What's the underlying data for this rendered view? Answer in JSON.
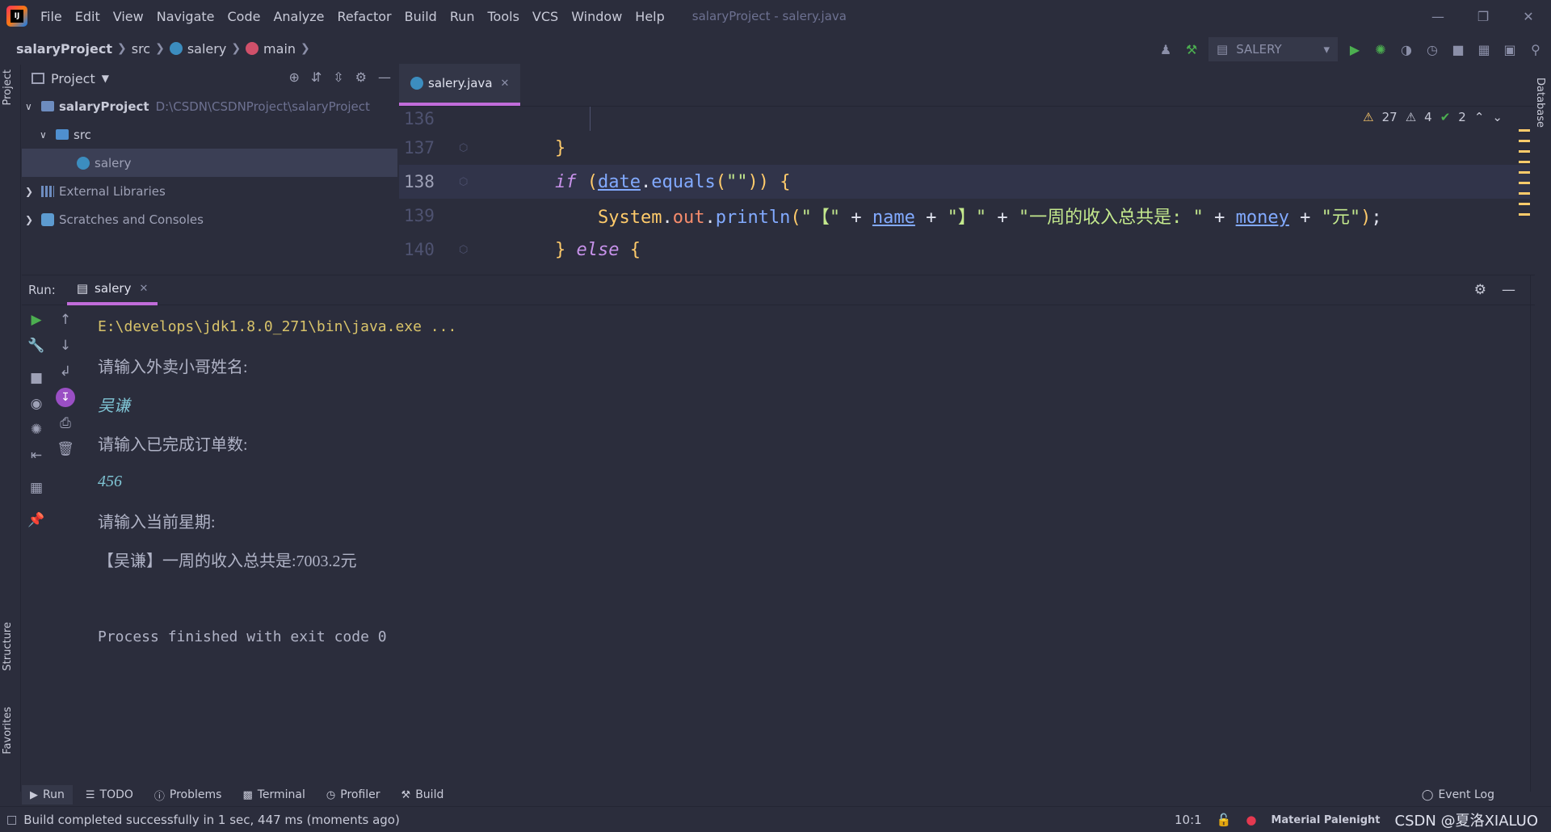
{
  "titlebar": {
    "logo_text": "IJ",
    "menu": [
      "File",
      "Edit",
      "View",
      "Navigate",
      "Code",
      "Analyze",
      "Refactor",
      "Build",
      "Run",
      "Tools",
      "VCS",
      "Window",
      "Help"
    ],
    "window_title": "salaryProject - salery.java"
  },
  "breadcrumb": [
    "salaryProject",
    "src",
    "salery",
    "main"
  ],
  "toolbar": {
    "run_config": "SALERY"
  },
  "left_strip": {
    "project": "Project",
    "structure": "Structure",
    "favorites": "Favorites"
  },
  "right_strip": {
    "database": "Database"
  },
  "project_panel": {
    "title": "Project",
    "tree": [
      {
        "label": "salaryProject",
        "path": "D:\\CSDN\\CSDNProject\\salaryProject"
      },
      {
        "label": "src"
      },
      {
        "label": "salery"
      },
      {
        "label": "External Libraries"
      },
      {
        "label": "Scratches and Consoles"
      }
    ]
  },
  "editor": {
    "tab": "salery.java",
    "inspections": {
      "warnings": "27",
      "weak_warnings": "4",
      "ok": "2"
    },
    "line_numbers": [
      "136",
      "137",
      "138",
      "139",
      "140"
    ]
  },
  "run_panel": {
    "label": "Run:",
    "tab": "salery",
    "console": [
      "E:\\develops\\jdk1.8.0_271\\bin\\java.exe ...",
      "请输入外卖小哥姓名:",
      "吴谦",
      "请输入已完成订单数:",
      "456",
      "请输入当前星期:",
      "【吴谦】一周的收入总共是:7003.2元",
      "",
      "Process finished with exit code 0"
    ]
  },
  "bottom_tabs": [
    "Run",
    "TODO",
    "Problems",
    "Terminal",
    "Profiler",
    "Build"
  ],
  "event_log": "Event Log",
  "status": {
    "message": "Build completed successfully in 1 sec, 447 ms (moments ago)",
    "position": "10:1",
    "theme": "Material Palenight",
    "watermark": "CSDN @夏洛XIALUO"
  },
  "colors": {
    "accent": "#c16cda",
    "background": "#2b2d3c",
    "warning": "#ffcb6b"
  }
}
